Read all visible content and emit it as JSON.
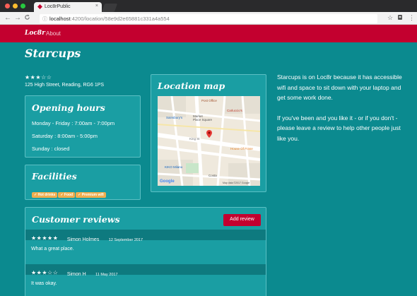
{
  "browser": {
    "tab_title": "Loc8rPublic",
    "tab_close": "×",
    "url_host": "localhost",
    "url_path": ":4200/location/58e9d2e65881c331a4a554",
    "url_info_icon": "ⓘ",
    "back_icon": "←",
    "forward_icon": "→",
    "reload_icon": "C",
    "star_icon": "☆",
    "menu_icon": "⋮"
  },
  "navbar": {
    "brand": "Loc8r",
    "about": "About"
  },
  "location": {
    "name": "Starcups",
    "rating": "★★★☆☆",
    "address": "125 High Street, Reading, RG6 1PS"
  },
  "hours": {
    "title": "Opening hours",
    "lines": [
      "Monday - Friday : 7:00am - 7:00pm",
      "Saturday : 8:00am - 5:00pm",
      "Sunday : closed"
    ]
  },
  "facilities": {
    "title": "Facilities",
    "items": [
      "✓ Hot drinks",
      "✓ Food",
      "✓ Premium wifi"
    ]
  },
  "map": {
    "title": "Location map",
    "labels": {
      "post_office": "Post Office",
      "sainsburys": "Sainsbury's",
      "market": "Market\nPlace Square",
      "cafe": "Carluccio's",
      "kings": "King St",
      "house": "House Of Frase",
      "kiko": "KIKO Milano",
      "costa": "Costa",
      "google": "Google",
      "copyright": "Map data ©2017 Google"
    }
  },
  "sidebar": {
    "para1": "Starcups is on Loc8r because it has accessible wifi and space to sit down with your laptop and get some work done.",
    "para2": "If you've been and you like it - or if you don't - please leave a review to help other people just like you."
  },
  "reviews": {
    "title": "Customer reviews",
    "add_button": "Add review",
    "items": [
      {
        "stars": "★★★★★",
        "author": "Simon Holmes",
        "date": "12 September 2017",
        "text": "What a great place."
      },
      {
        "stars": "★★★☆☆",
        "author": "Simon H",
        "date": "11 May 2017",
        "text": "It was okay."
      }
    ]
  }
}
